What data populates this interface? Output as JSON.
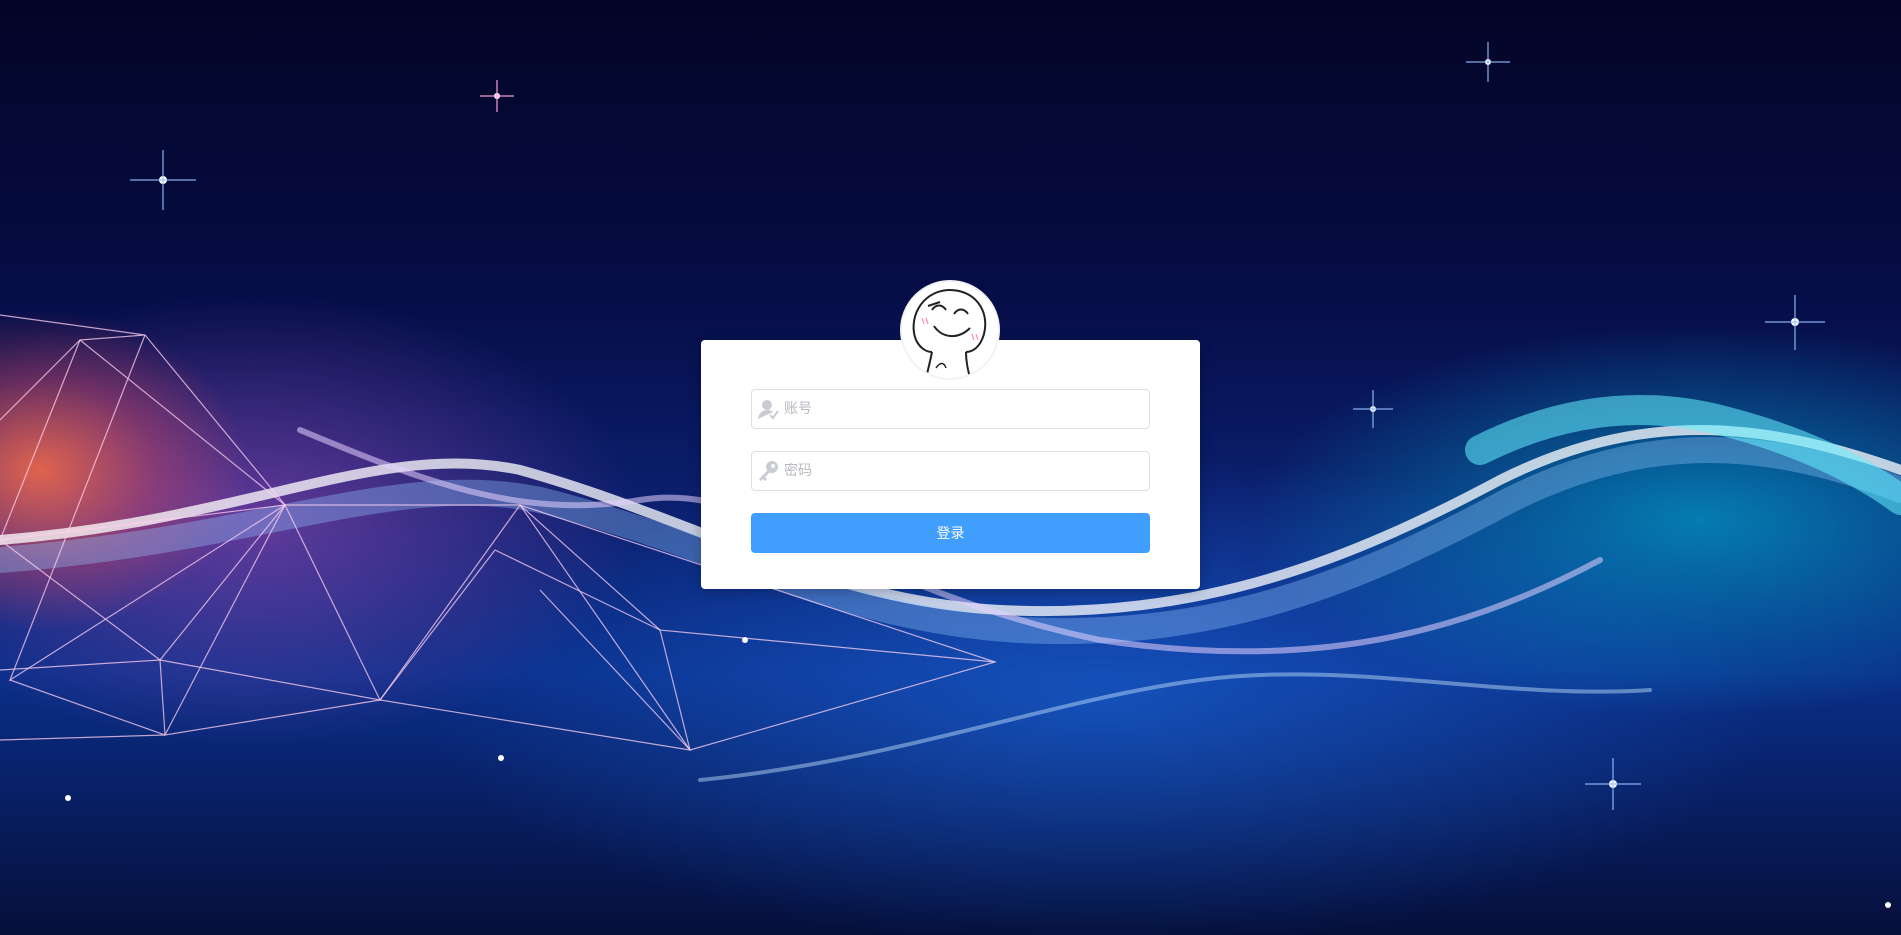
{
  "login": {
    "username_placeholder": "账号",
    "password_placeholder": "密码",
    "submit_label": "登录"
  },
  "icons": {
    "username": "user-icon",
    "password": "key-icon",
    "avatar": "smiley-face-avatar"
  },
  "colors": {
    "primary_button": "#409eff",
    "card_background": "#ffffff",
    "input_border": "#dcdfe6",
    "placeholder": "#b7b9bf"
  }
}
